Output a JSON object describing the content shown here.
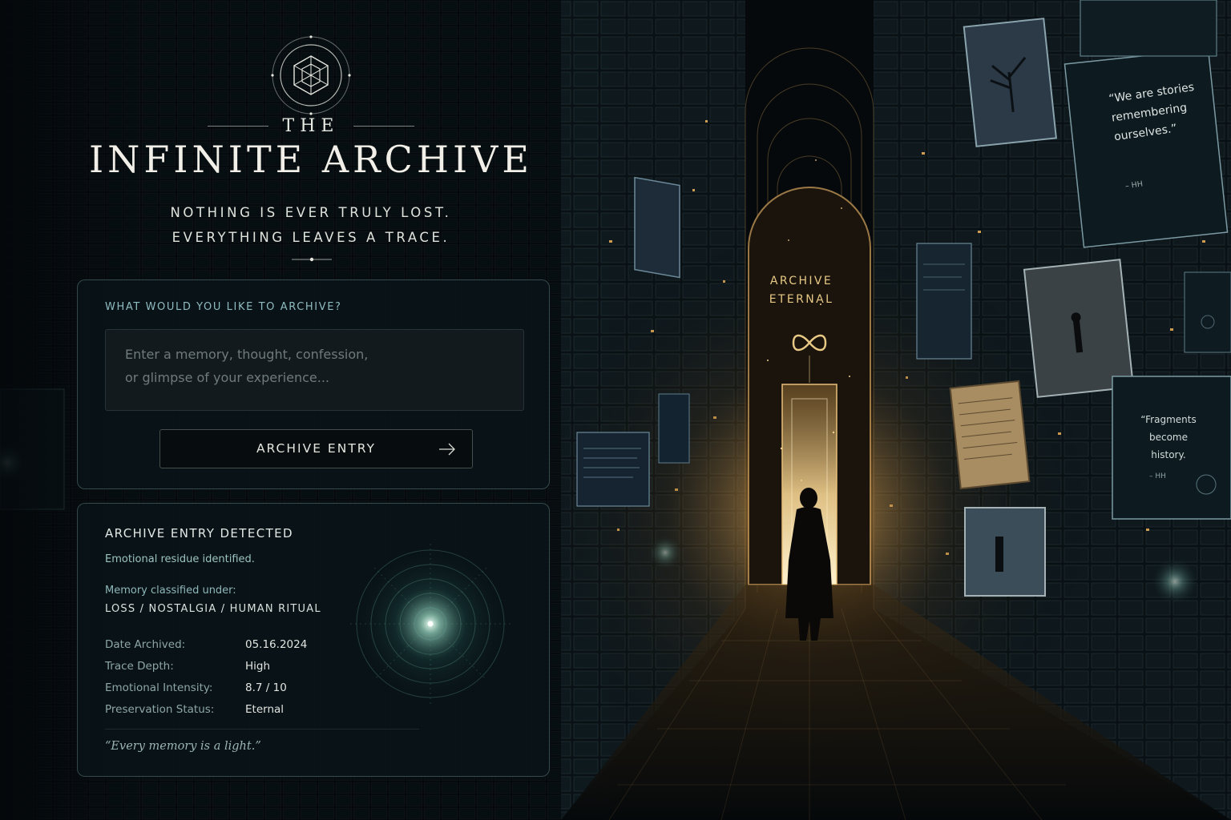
{
  "header": {
    "the_word": "THE",
    "title": "INFINITE ARCHIVE",
    "tagline_line1": "NOTHING IS EVER TRULY LOST.",
    "tagline_line2": "EVERYTHING LEAVES A TRACE."
  },
  "entry_form": {
    "prompt_label": "WHAT WOULD YOU LIKE TO ARCHIVE?",
    "placeholder": "Enter a memory, thought, confession,\nor glimpse of your experience...",
    "button_label": "ARCHIVE ENTRY"
  },
  "result": {
    "title": "ARCHIVE ENTRY DETECTED",
    "subtitle": "Emotional residue identified.",
    "classification_label": "Memory classified under:",
    "classification_value": "LOSS / NOSTALGIA / HUMAN RITUAL",
    "meta": [
      {
        "key": "Date Archived:",
        "value": "05.16.2024"
      },
      {
        "key": "Trace Depth:",
        "value": "High"
      },
      {
        "key": "Emotional Intensity:",
        "value": "8.7 / 10"
      },
      {
        "key": "Preservation Status:",
        "value": "Eternal"
      }
    ],
    "quote": "“Every memory is a light.”"
  },
  "scene": {
    "door_line1": "ARCHIVE",
    "door_line2": "ETERNAL",
    "quote_card_1": "“We are stories remembering ourselves.”",
    "quote_card_1_sig": "– HH",
    "quote_card_2": "“Fragments become history.",
    "quote_card_2_sig": "– HH"
  },
  "colors": {
    "background": "#05090c",
    "accent_teal": "#8fbcc0",
    "accent_gold": "#e8c985",
    "panel_border": "#7fa3a3"
  },
  "icons": [
    "archive-logo-icon",
    "arrow-right-icon",
    "radar-icon",
    "infinity-icon"
  ]
}
